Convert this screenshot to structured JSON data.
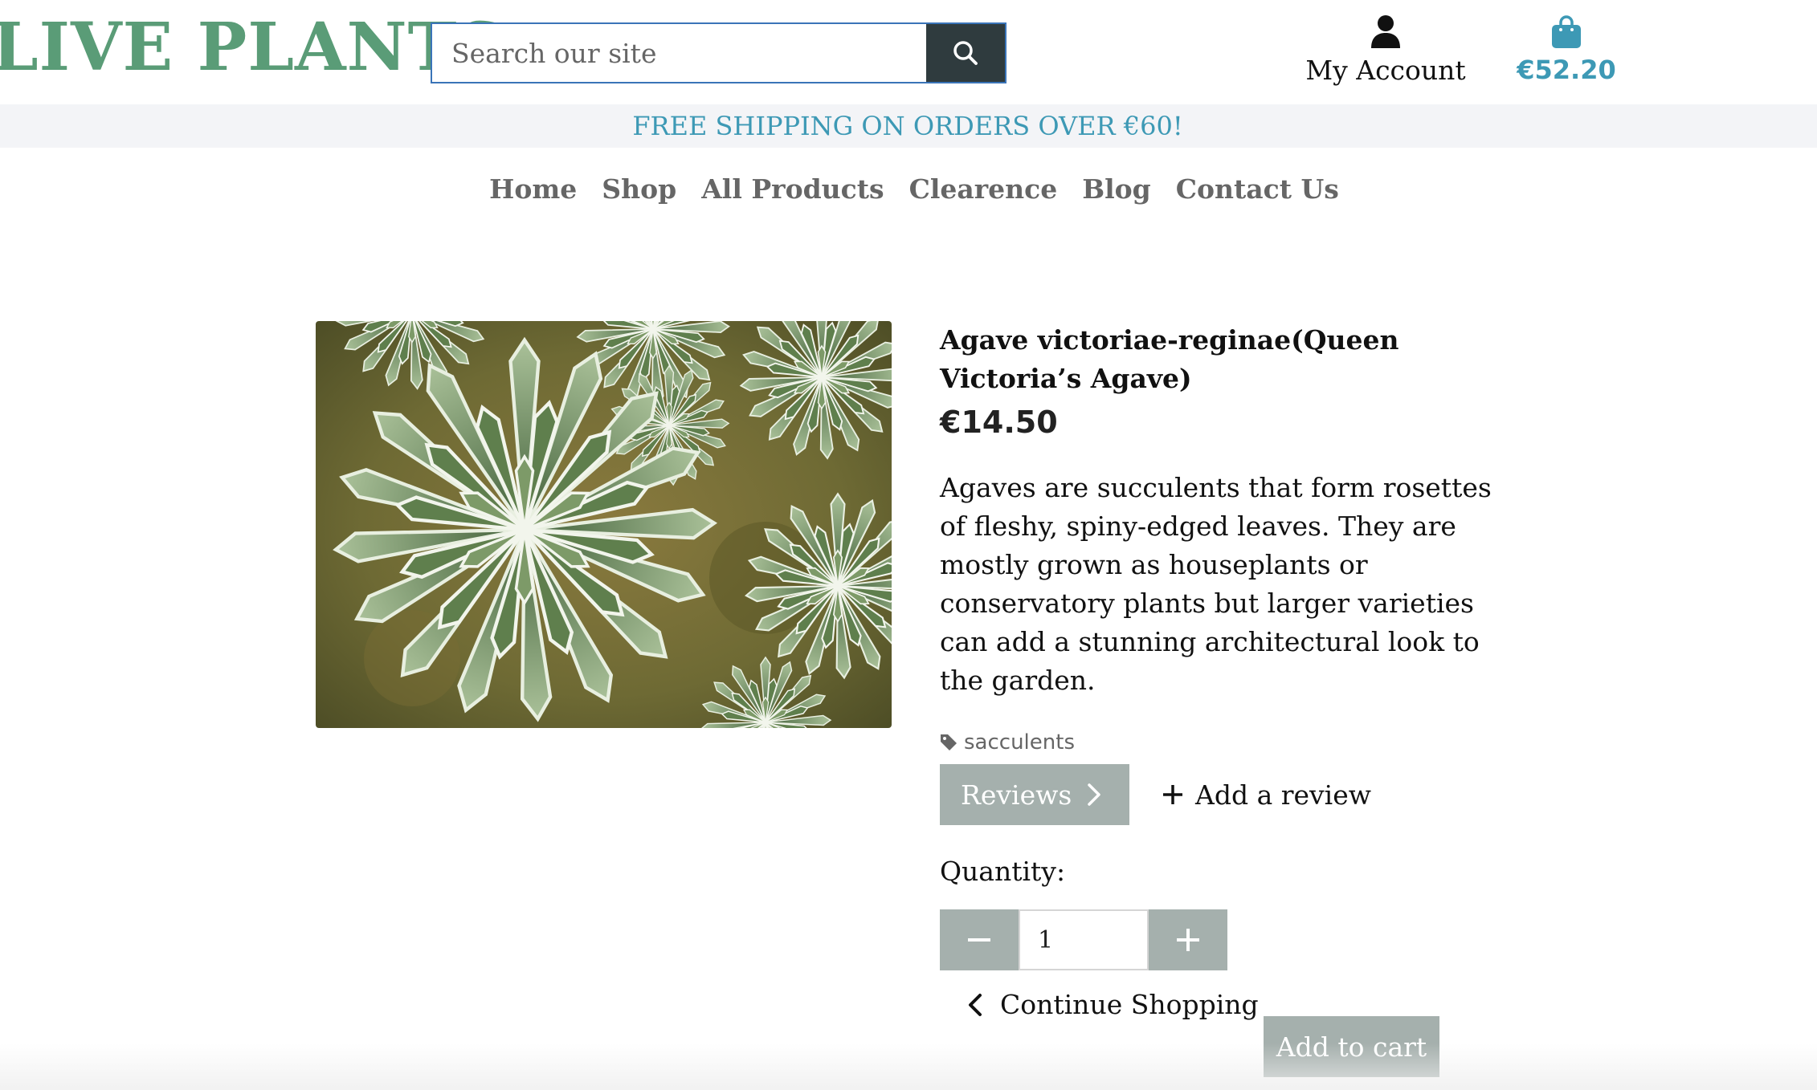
{
  "brand": {
    "logo_text": "LIVE PLANTS",
    "color": "#5a9c77"
  },
  "search": {
    "placeholder": "Search our site",
    "button_icon": "search-icon"
  },
  "account": {
    "icon": "user-icon",
    "label": "My Account"
  },
  "cart": {
    "icon": "shopping-bag-icon",
    "total": "€52.20",
    "color": "#3d99b5"
  },
  "banner": {
    "text": "FREE SHIPPING ON ORDERS OVER €60!"
  },
  "nav": {
    "items": [
      {
        "label": "Home"
      },
      {
        "label": "Shop"
      },
      {
        "label": "All Products"
      },
      {
        "label": "Clearence"
      },
      {
        "label": "Blog"
      },
      {
        "label": "Contact Us"
      }
    ]
  },
  "product": {
    "name": "Agave victoriae-reginae(Queen Victoria’s Agave)",
    "price": "€14.50",
    "description": "Agaves are succulents that form rosettes of fleshy, spiny-edged leaves. They are mostly grown as houseplants or conservatory plants but larger varieties can add a stunning architectural look to the garden.",
    "category": "sacculents",
    "category_icon": "tag-icon",
    "image_alt": "Agave plant photo"
  },
  "reviews": {
    "button_label": "Reviews",
    "add_label": "Add a review"
  },
  "quantity": {
    "label": "Quantity:",
    "value": "1"
  },
  "actions": {
    "continue_label": "Continue Shopping",
    "add_to_cart_label": "Add to cart"
  },
  "colors": {
    "button_gray": "#a5b0ad",
    "search_button": "#2f3b3e",
    "banner_bg": "#f3f4f7"
  }
}
